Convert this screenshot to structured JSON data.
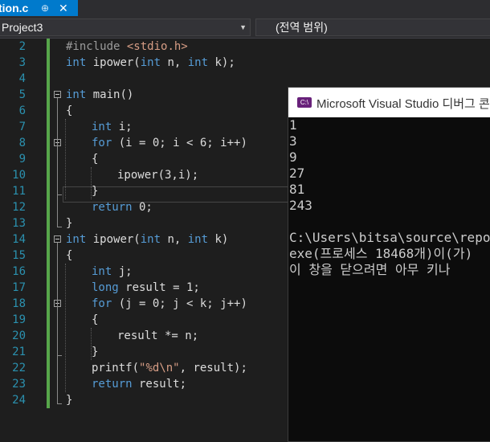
{
  "tab": {
    "filename": "tion.c",
    "pin": "⊕",
    "close": "✕"
  },
  "navbar": {
    "project": "Project3",
    "scope": "(전역 범위)",
    "arrow": "▼"
  },
  "editor": {
    "lines": [
      {
        "num": "2",
        "code": "#include <stdio.h>"
      },
      {
        "num": "3",
        "code": "int ipower(int n, int k);"
      },
      {
        "num": "4",
        "code": ""
      },
      {
        "num": "5",
        "code": "int main()"
      },
      {
        "num": "6",
        "code": "{"
      },
      {
        "num": "7",
        "code": "int i;"
      },
      {
        "num": "8",
        "code": "for (i = 0; i < 6; i++)"
      },
      {
        "num": "9",
        "code": "{"
      },
      {
        "num": "10",
        "code": "ipower(3,i);"
      },
      {
        "num": "11",
        "code": "}"
      },
      {
        "num": "12",
        "code": "return 0;"
      },
      {
        "num": "13",
        "code": "}"
      },
      {
        "num": "14",
        "code": "int ipower(int n, int k)"
      },
      {
        "num": "15",
        "code": "{"
      },
      {
        "num": "16",
        "code": "int j;"
      },
      {
        "num": "17",
        "code": "long result = 1;"
      },
      {
        "num": "18",
        "code": "for (j = 0; j < k; j++)"
      },
      {
        "num": "19",
        "code": "{"
      },
      {
        "num": "20",
        "code": "result *= n;"
      },
      {
        "num": "21",
        "code": "}"
      },
      {
        "num": "22",
        "code": "printf(\"%d\\n\", result);"
      },
      {
        "num": "23",
        "code": "return result;"
      },
      {
        "num": "24",
        "code": "}"
      }
    ]
  },
  "console": {
    "title": "Microsoft Visual Studio 디버그 콘",
    "icon_label": "C:\\",
    "output": [
      "1",
      "3",
      "9",
      "27",
      "81",
      "243",
      "",
      "C:\\Users\\bitsa\\source\\repos",
      "exe(프로세스 18468개)이(가) ",
      "이 창을 닫으려면 아무 키나 "
    ]
  }
}
